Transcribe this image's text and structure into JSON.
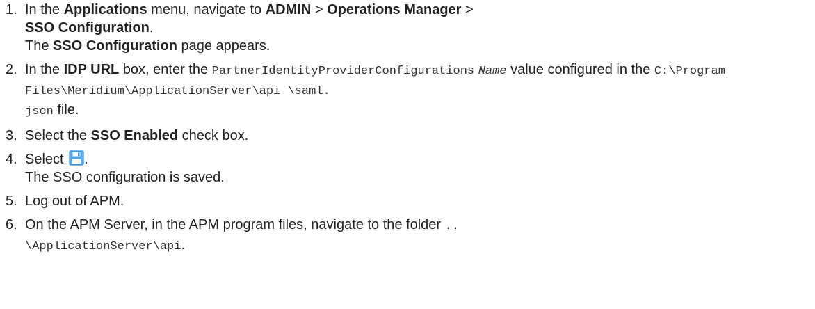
{
  "steps": [
    {
      "number": "1.",
      "parts": [
        "In the ",
        "Applications",
        " menu, navigate to ",
        "ADMIN",
        " > ",
        "Operations Manager",
        " > ",
        "SSO Configuration",
        "."
      ],
      "result": [
        "The ",
        "SSO Configuration",
        " page appears."
      ]
    },
    {
      "number": "2.",
      "parts": [
        "In the ",
        "IDP URL",
        " box, enter the ",
        "PartnerIdentityProviderConfigurations",
        "Name",
        " value configured in the ",
        "C:\\Program Files\\Meridium\\ApplicationServer\\api \\saml.",
        "json",
        " file."
      ]
    },
    {
      "number": "3.",
      "parts": [
        "Select the ",
        "SSO Enabled",
        " check box."
      ]
    },
    {
      "number": "4.",
      "parts": [
        "Select ",
        "."
      ],
      "icon": "save-icon",
      "result": [
        "The SSO configuration is saved."
      ]
    },
    {
      "number": "5.",
      "parts": [
        "Log out of APM."
      ]
    },
    {
      "number": "6.",
      "parts": [
        "On the APM Server, in the APM program files, navigate to the folder ",
        "..",
        "\\ApplicationServer\\api",
        "."
      ]
    }
  ],
  "colors": {
    "text": "#222222",
    "icon_blue": "#2e8fd6"
  }
}
